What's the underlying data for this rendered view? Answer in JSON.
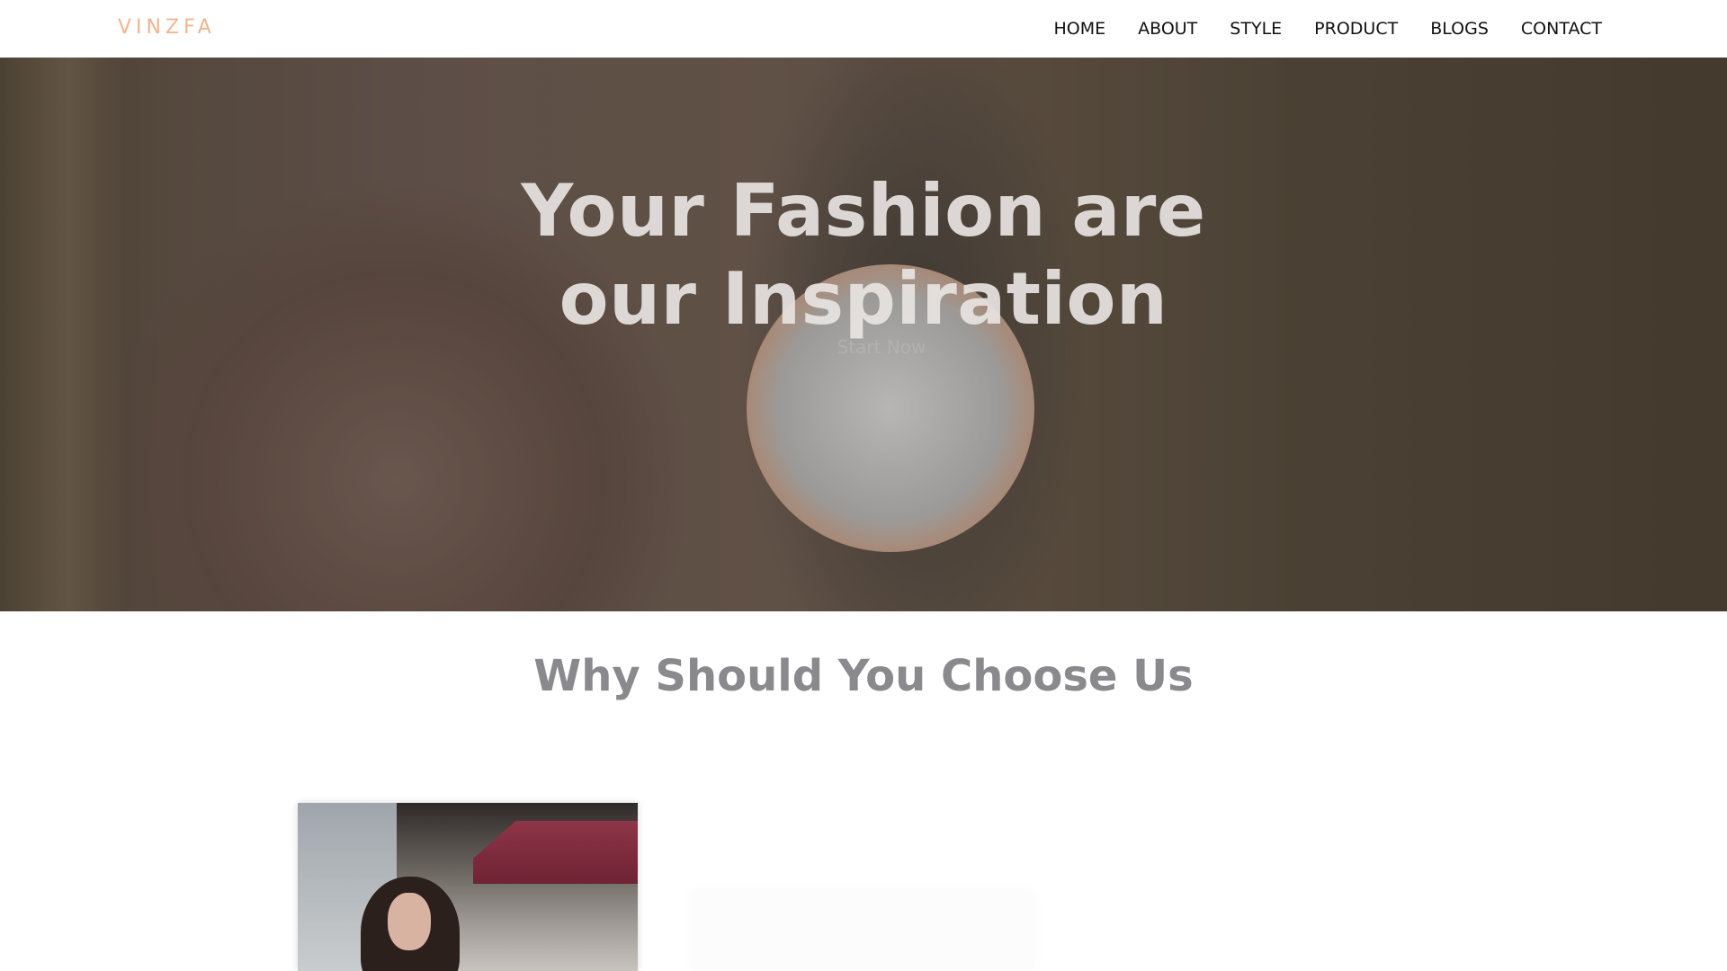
{
  "brand": {
    "logo": "VINZFA",
    "logo_color": "#f2b48f"
  },
  "nav": {
    "items": [
      {
        "label": "HOME"
      },
      {
        "label": "ABOUT"
      },
      {
        "label": "STYLE"
      },
      {
        "label": "PRODUCT"
      },
      {
        "label": "BLOGS"
      },
      {
        "label": "CONTACT"
      }
    ]
  },
  "hero": {
    "title_line1": "Your Fashion are",
    "title_line2": "our Inspiration",
    "button_label": "Start Now"
  },
  "section": {
    "title": "Why Should You Choose Us"
  },
  "colors": {
    "heading_gray": "#8a8a8e",
    "nav_text": "#111111",
    "background": "#ffffff"
  }
}
